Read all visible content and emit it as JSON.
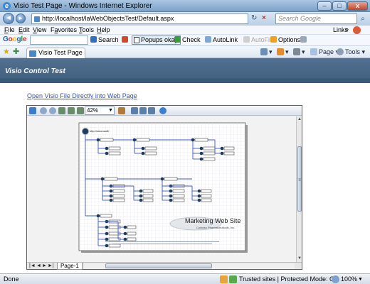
{
  "window": {
    "title": "Visio Test Page - Windows Internet Explorer",
    "buttons": [
      "–",
      "□",
      "x"
    ]
  },
  "address": {
    "url": "http://localhost/laWebObjectsTest/Default.aspx",
    "search_placeholder": "Search Google",
    "icons": {
      "back": "◄",
      "forward": "►",
      "lock": "♦",
      "refresh": "↻",
      "stop": "×",
      "search": "⌕"
    }
  },
  "menu": {
    "items": [
      {
        "label": "File",
        "ul": "F",
        "rest": "ile"
      },
      {
        "label": "Edit",
        "ul": "E",
        "rest": "dit"
      },
      {
        "label": "View",
        "ul": "V",
        "rest": "iew"
      },
      {
        "label": "Favorites",
        "ul": "a",
        "pre": "F",
        "rest": "vorites"
      },
      {
        "label": "Tools",
        "ul": "T",
        "rest": "ools"
      },
      {
        "label": "Help",
        "ul": "H",
        "rest": "elp"
      }
    ],
    "links_label": "Links",
    "links_chevron": "»"
  },
  "google_toolbar": {
    "logo": "Google",
    "search_label": "Search",
    "popups_label": "Popups okay",
    "check_label": "Check",
    "autolink_label": "AutoLink",
    "autofill_label": "AutoFill",
    "options_label": "Options"
  },
  "tabs": {
    "active": "Visio Test Page",
    "commands": {
      "page": "Page",
      "tools": "Tools"
    }
  },
  "page": {
    "header_title": "Visio Control Test",
    "link_text": "Open Visio File Directly into Web Page"
  },
  "visio": {
    "zoom": "42%",
    "page_tab": "Page-1",
    "nav_arrows": [
      "|◄",
      "◄",
      "►",
      "►|"
    ],
    "scroll_arrows": [
      "▲",
      "▼",
      "≡"
    ],
    "diagram": {
      "root_label": "http://microsoft/",
      "logo_title": "Marketing Web Site",
      "logo_subtitle": "Contoso Pharmaceuticals, Inc."
    }
  },
  "status": {
    "left": "Done",
    "zone": "Trusted sites | Protected Mode: Off",
    "zoom": "100%",
    "zoom_arrow": "▼"
  },
  "colors": {
    "accent_blue": "#3055a8",
    "site_header": "#4a6a8c",
    "node_dark": "#1f3b5a",
    "connector": "#3b55c8"
  }
}
